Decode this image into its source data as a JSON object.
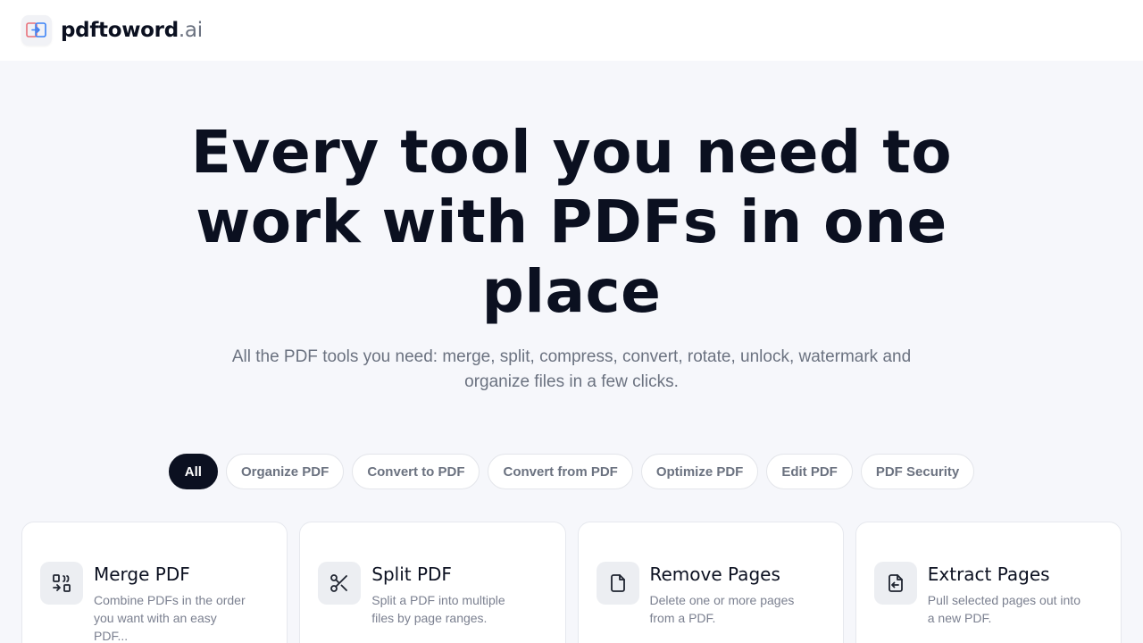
{
  "brand": {
    "name": "pdftoword",
    "tld": ".ai"
  },
  "hero": {
    "title": "Every tool you need to work with PDFs in one place",
    "subtitle": "All the PDF tools you need: merge, split, compress, convert, rotate, unlock, watermark and organize files in a few clicks."
  },
  "filters": [
    {
      "label": "All",
      "active": true
    },
    {
      "label": "Organize PDF"
    },
    {
      "label": "Convert to PDF"
    },
    {
      "label": "Convert from PDF"
    },
    {
      "label": "Optimize PDF"
    },
    {
      "label": "Edit PDF"
    },
    {
      "label": "PDF Security"
    }
  ],
  "tools": [
    {
      "title": "Merge PDF",
      "desc": "Combine PDFs in the order you want with an easy PDF...",
      "icon": "merge-icon"
    },
    {
      "title": "Split PDF",
      "desc": "Split a PDF into multiple files by page ranges.",
      "icon": "scissors-icon"
    },
    {
      "title": "Remove Pages",
      "desc": "Delete one or more pages from a PDF.",
      "icon": "file-icon"
    },
    {
      "title": "Extract Pages",
      "desc": "Pull selected pages out into a new PDF.",
      "icon": "file-export-icon"
    }
  ],
  "colors": {
    "primary": "#0b1020",
    "muted": "#6b7280",
    "background": "#f6f7fb"
  }
}
